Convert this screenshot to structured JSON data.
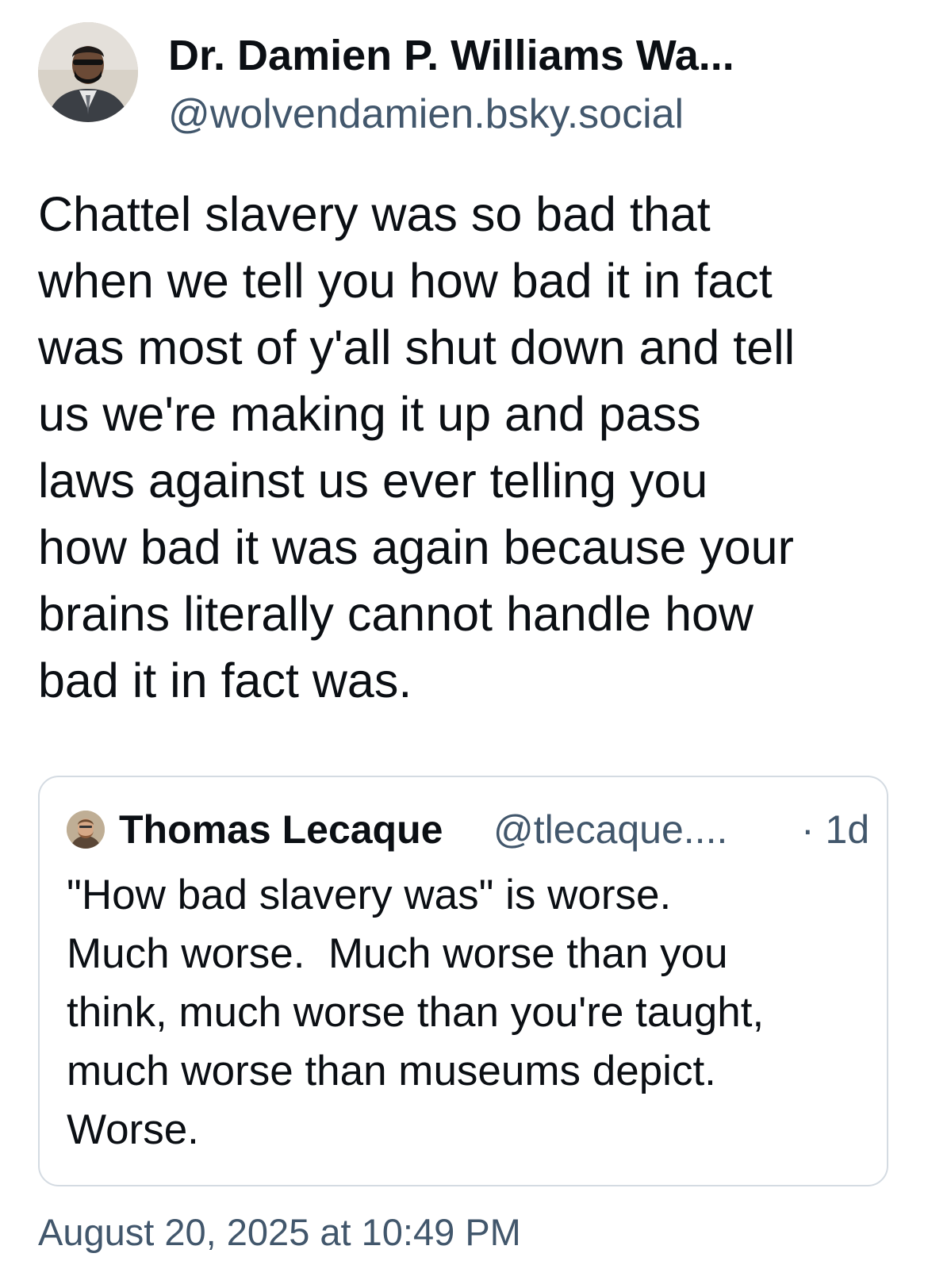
{
  "author": {
    "avatar_icon": "user-photo-avatar",
    "display_name": "Dr. Damien P. Williams Wa...",
    "handle": "@wolvendamien.bsky.social"
  },
  "post": {
    "text_lines": [
      "Chattel slavery was so bad that",
      "when we tell you how bad it in fact",
      "was most of y'all shut down and tell",
      "us we're making it up and pass",
      "laws against us ever telling you",
      "how bad it was again because your",
      "brains literally cannot handle how",
      "bad it in fact was."
    ],
    "timestamp": "August 20, 2025 at 10:49 PM"
  },
  "quoted_post": {
    "avatar_icon": "user-photo-avatar",
    "display_name": "Thomas Lecaque",
    "handle": "@tlecaque....",
    "age": "· 1d",
    "text_lines": [
      "\"How bad slavery was\" is worse.",
      "Much worse.  Much worse than you",
      "think, much worse than you're taught,",
      "much worse than museums depict.",
      "Worse."
    ]
  },
  "colors": {
    "text_primary": "#0b0f14",
    "text_secondary": "#42576c",
    "card_border": "#d4dbe2",
    "background": "#ffffff"
  }
}
